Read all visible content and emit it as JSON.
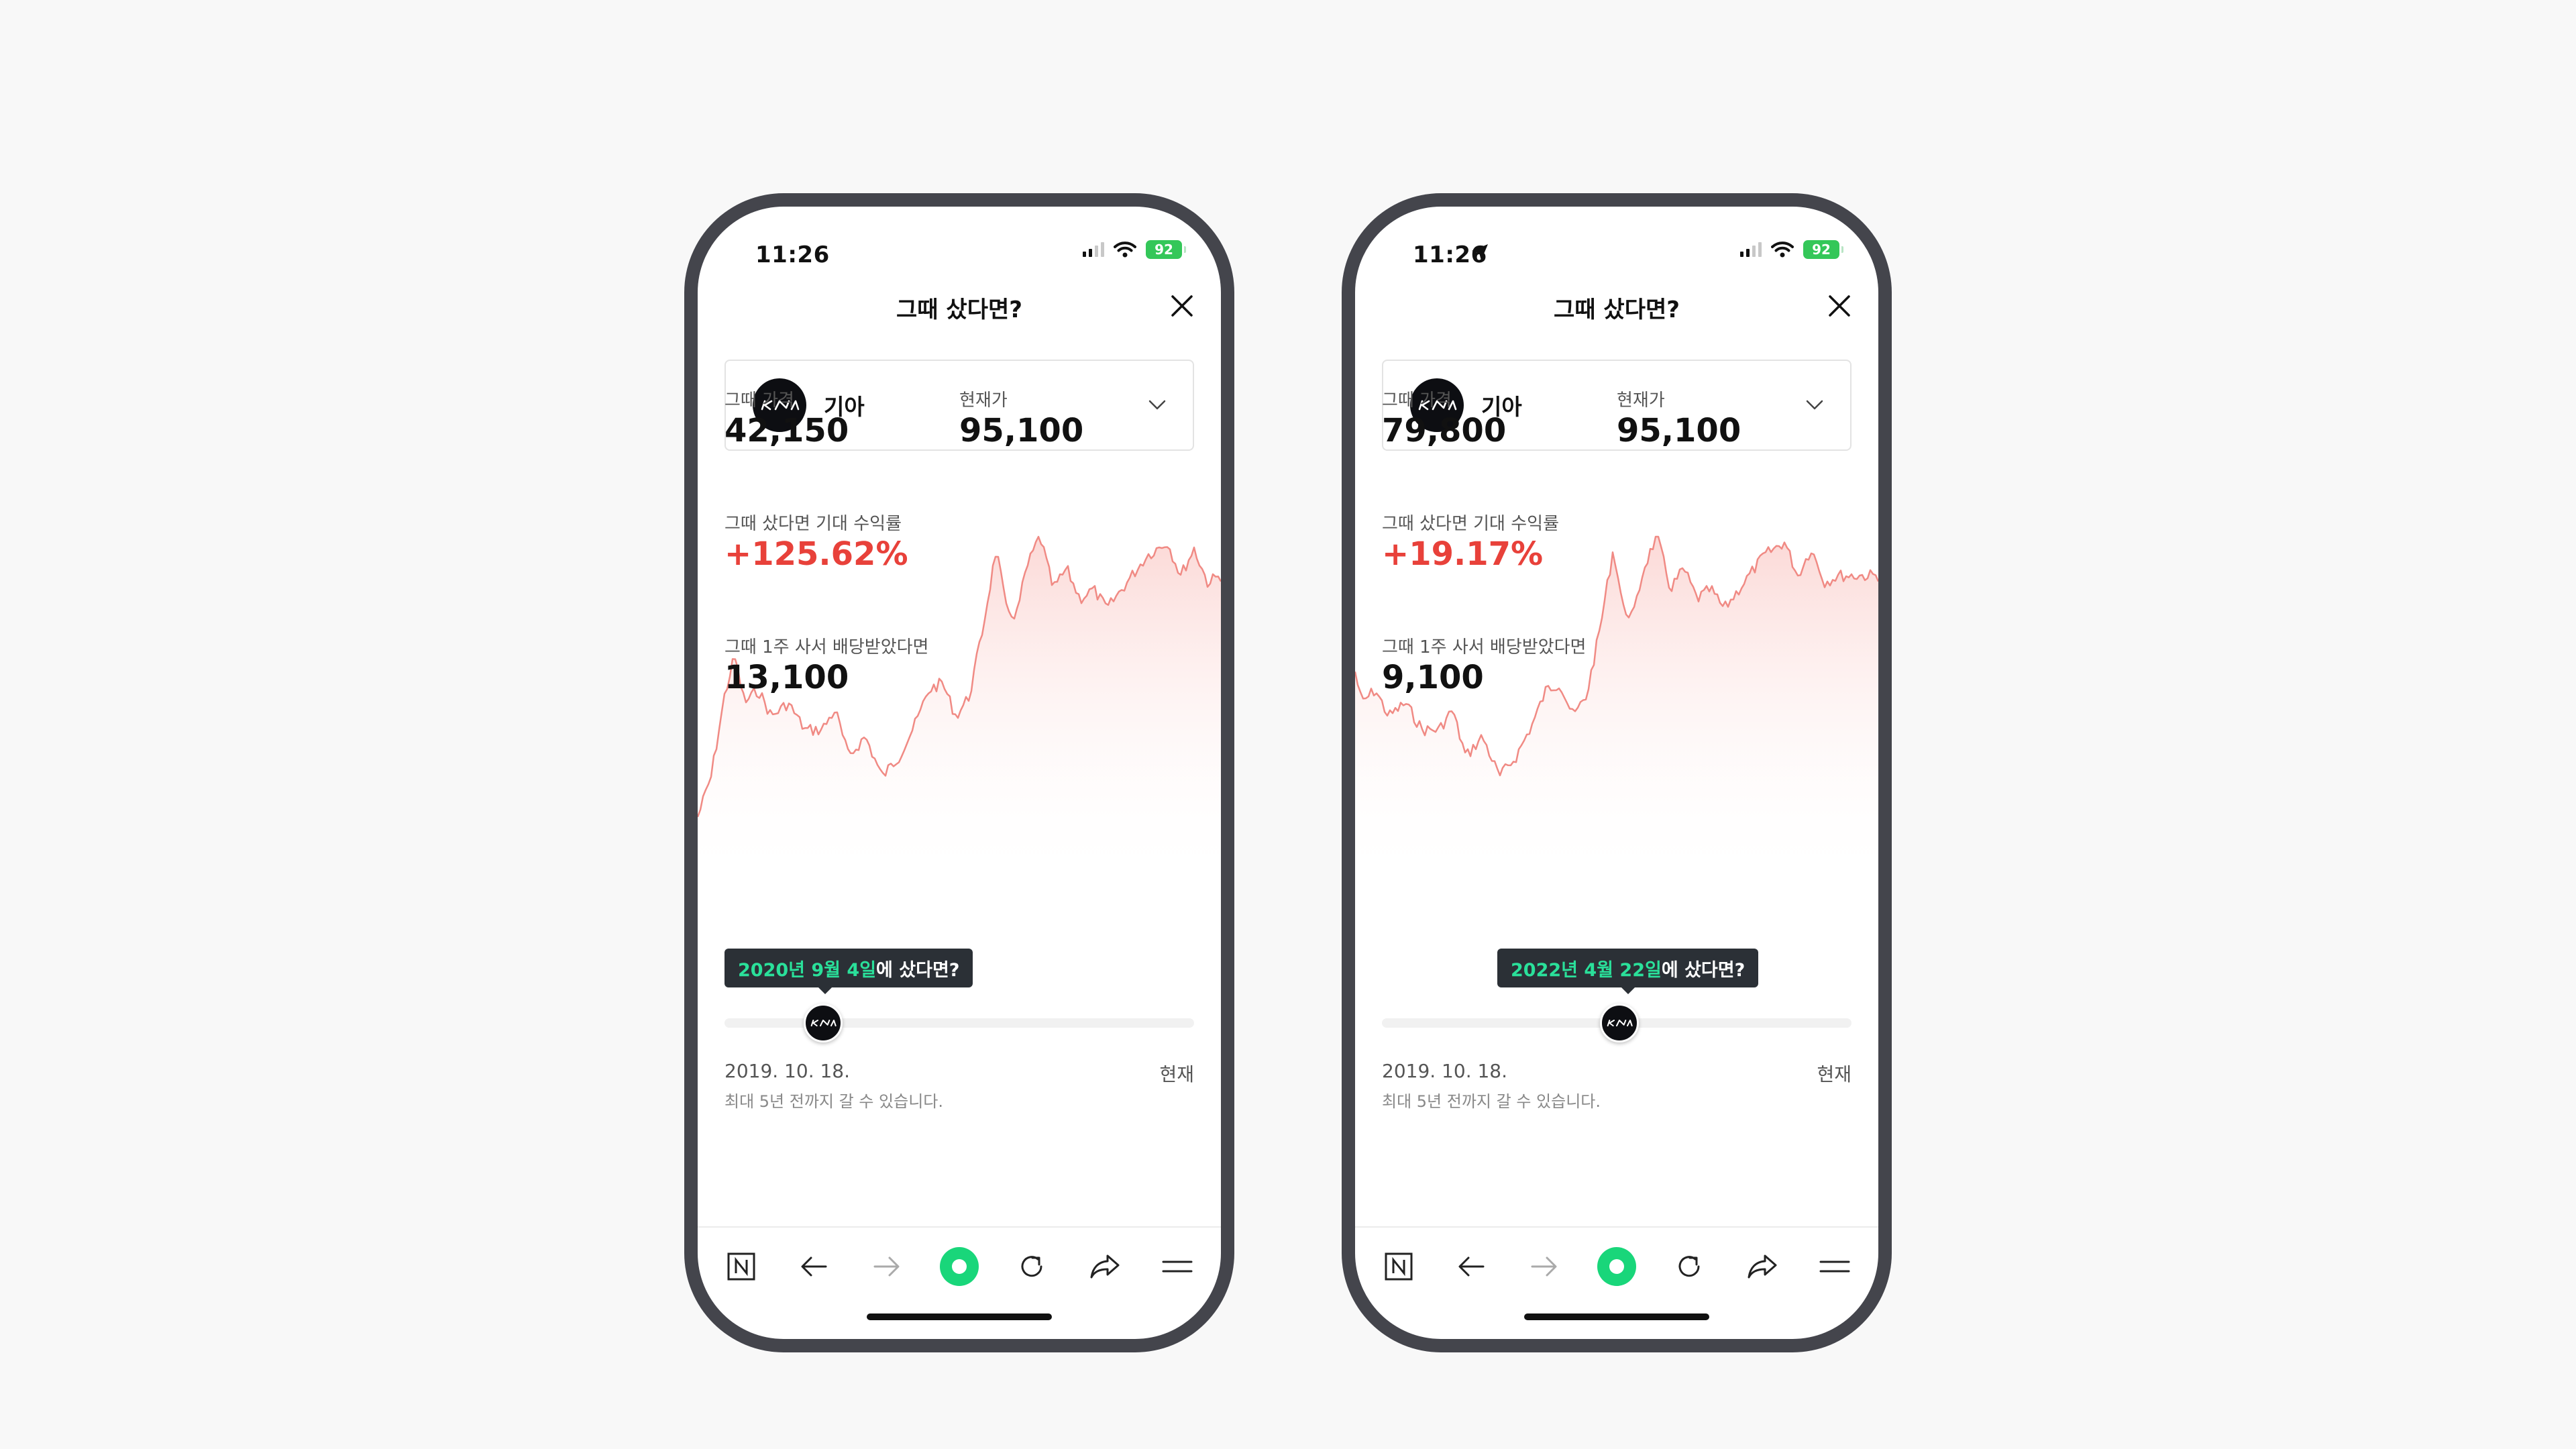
{
  "phones": [
    {
      "status": {
        "time": "11:26",
        "battery": "92"
      },
      "header": {
        "title": "그때 샀다면?"
      },
      "stock": {
        "name": "기아"
      },
      "metrics": {
        "then_price_label": "그때 가격",
        "then_price": "42,150",
        "current_price_label": "현재가",
        "current_price": "95,100",
        "return_label": "그때 샀다면 기대 수익률",
        "return_value": "+125.62%",
        "dividend_label": "그때 1주 사서 배당받았다면",
        "dividend_value": "13,100"
      },
      "tooltip": {
        "date": "2020년 9월 4일",
        "suffix": "에 샀다면?"
      },
      "slider": {
        "position": 0.21,
        "start_label": "2019. 10. 18.",
        "end_label": "현재",
        "note": "최대 5년 전까지 갈 수 있습니다."
      }
    },
    {
      "status": {
        "time": "11:26",
        "battery": "92"
      },
      "header": {
        "title": "그때 샀다면?"
      },
      "stock": {
        "name": "기아"
      },
      "metrics": {
        "then_price_label": "그때 가격",
        "then_price": "79,800",
        "current_price_label": "현재가",
        "current_price": "95,100",
        "return_label": "그때 샀다면 기대 수익률",
        "return_value": "+19.17%",
        "dividend_label": "그때 1주 사서 배당받았다면",
        "dividend_value": "9,100"
      },
      "tooltip": {
        "date": "2022년 4월 22일",
        "suffix": "에 샀다면?"
      },
      "slider": {
        "position": 0.505,
        "start_label": "2019. 10. 18.",
        "end_label": "현재",
        "note": "최대 5년 전까지 갈 수 있습니다."
      }
    }
  ],
  "colors": {
    "return_red": "#e8413a",
    "accent_green": "#2ae09a",
    "chart_line": "#f08a84"
  },
  "icons": [
    "signal-icon",
    "wifi-icon",
    "battery-icon",
    "location-arrow-icon",
    "close-icon",
    "kia-logo-icon",
    "chevron-down-icon",
    "naver-n-icon",
    "back-arrow-icon",
    "forward-arrow-icon",
    "green-dot-icon",
    "refresh-icon",
    "share-icon",
    "menu-icon"
  ]
}
